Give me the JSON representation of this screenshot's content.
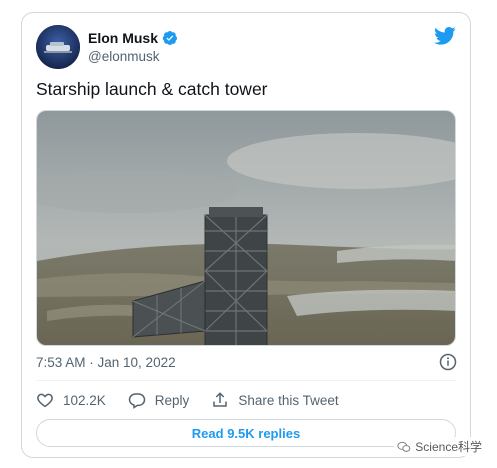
{
  "tweet": {
    "author_name": "Elon Musk",
    "handle": "@elonmusk",
    "text": "Starship launch & catch tower",
    "timestamp": "7:53 AM · Jan 10, 2022",
    "like_count": "102.2K",
    "reply_label": "Reply",
    "share_label": "Share this Tweet",
    "read_replies_label": "Read 9.5K replies"
  },
  "icons": {
    "brand": "twitter-bird-icon",
    "verified": "verified-badge-icon",
    "info": "info-icon",
    "like": "heart-icon",
    "reply": "reply-bubble-icon",
    "share": "share-upload-icon"
  },
  "colors": {
    "brand_blue": "#1d9bf0",
    "text_primary": "#0f1419",
    "text_secondary": "#536471",
    "border": "#cfd9de"
  },
  "watermark": {
    "text": "Science科学"
  }
}
